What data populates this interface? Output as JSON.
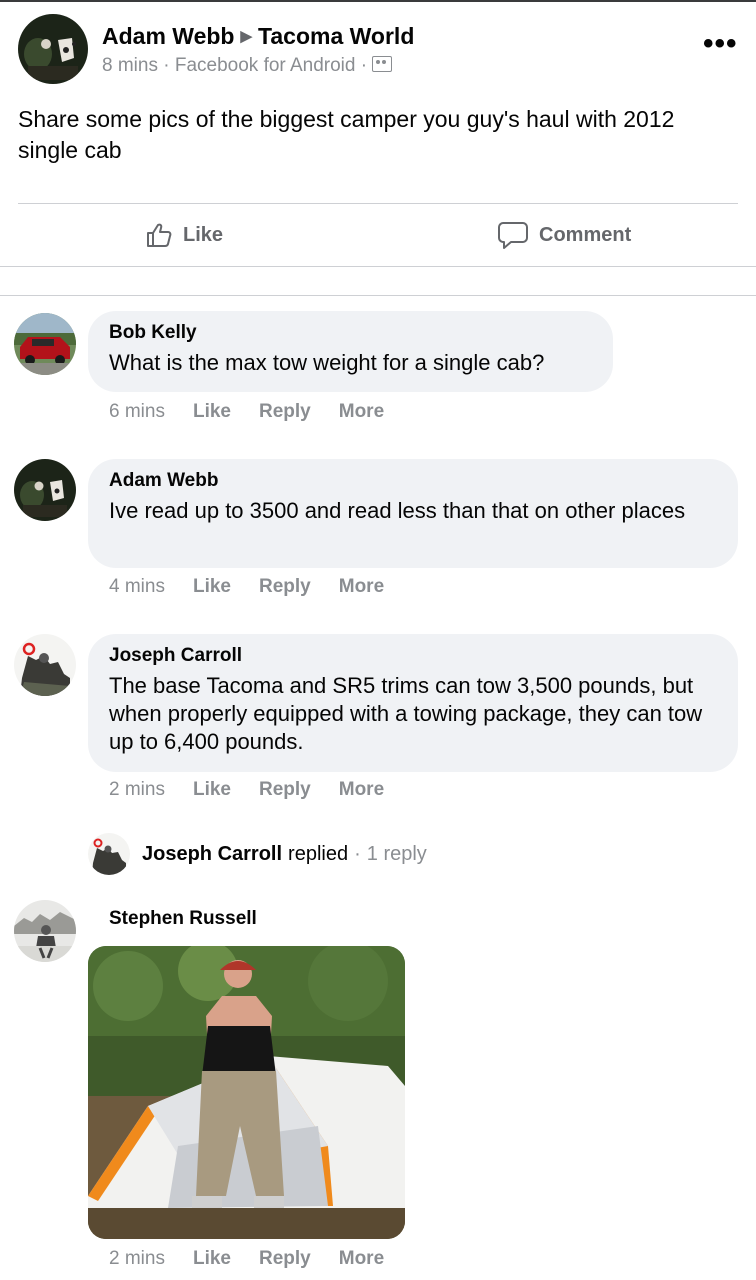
{
  "post": {
    "author": "Adam Webb",
    "group": "Tacoma World",
    "time": "8 mins",
    "separator": "·",
    "source": "Facebook for Android",
    "text": "Share some pics of the biggest camper you guy's haul with 2012 single cab",
    "like_label": "Like",
    "comment_label": "Comment",
    "more_glyph": "•••"
  },
  "comments": [
    {
      "author": "Bob Kelly",
      "text": "What is the max tow weight for a single cab?",
      "time": "6 mins",
      "like": "Like",
      "reply": "Reply",
      "more": "More"
    },
    {
      "author": "Adam Webb",
      "text": "Ive read up to 3500 and read less than that on other places",
      "time": "4 mins",
      "like": "Like",
      "reply": "Reply",
      "more": "More"
    },
    {
      "author": "Joseph Carroll",
      "text": "The base Tacoma and SR5 trims can tow 3,500 pounds, but when properly equipped with a towing package, they can tow up to 6,400 pounds.",
      "time": "2 mins",
      "like": "Like",
      "reply": "Reply",
      "more": "More"
    },
    {
      "author": "Stephen Russell",
      "time": "2 mins",
      "like": "Like",
      "reply": "Reply",
      "more": "More"
    }
  ],
  "reply_summary": {
    "author": "Joseph Carroll",
    "verb": "replied",
    "separator": "·",
    "count": "1 reply"
  },
  "colors": {
    "secondary_text": "#8a8d91",
    "bubble": "#f0f2f5",
    "divider": "#ced0d4"
  }
}
